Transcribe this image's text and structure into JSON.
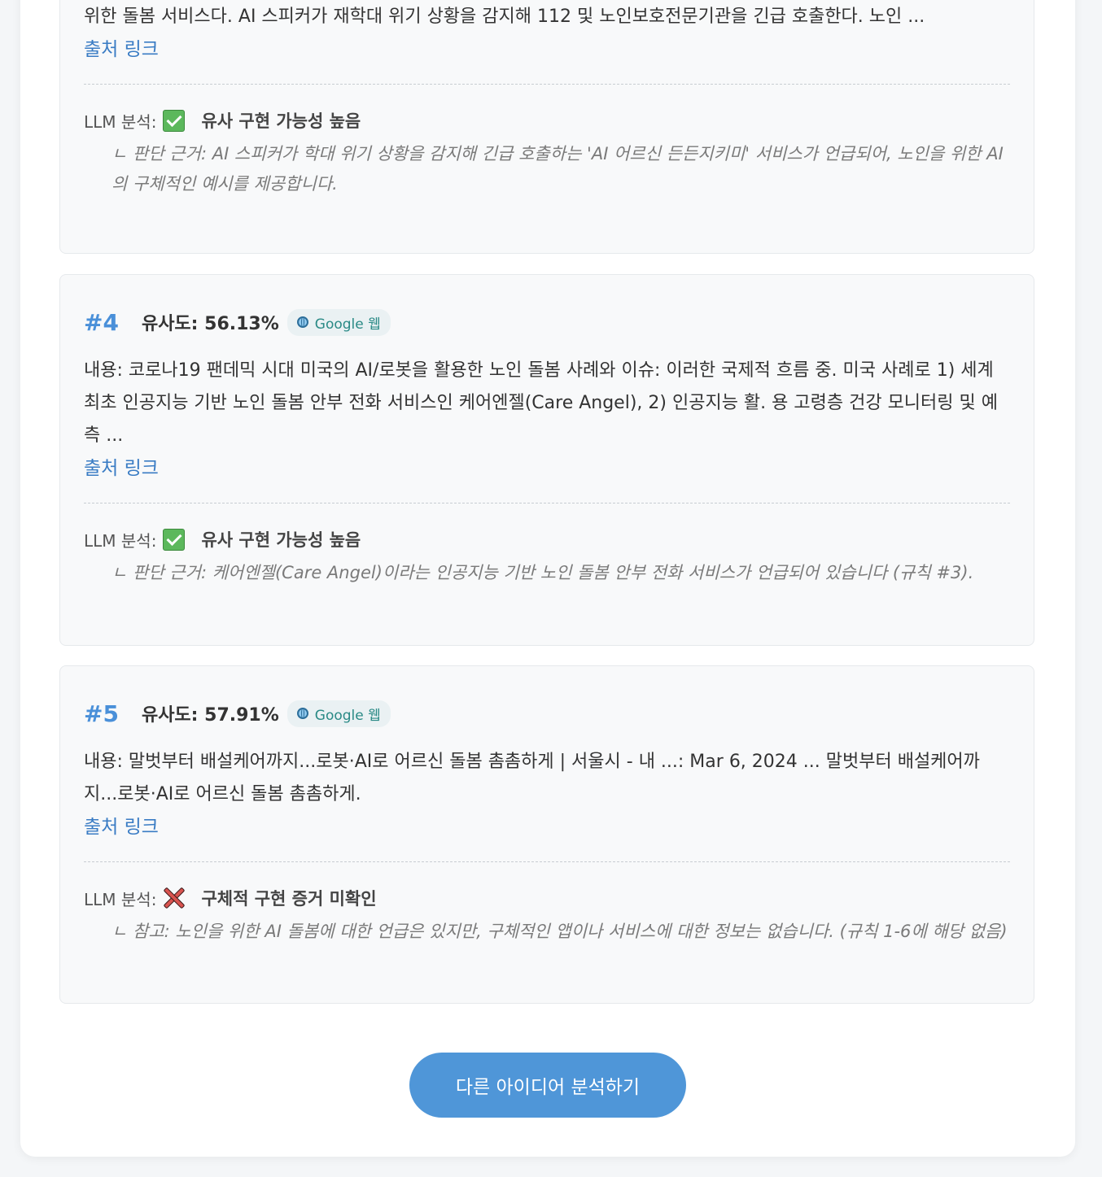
{
  "results": [
    {
      "content": "위한 돌봄 서비스다. AI 스피커가 재학대 위기 상황을 감지해 112 및 노인보호전문기관을 긴급 호출한다. 노인 ...",
      "link_label": "출처 링크",
      "llm_label": "LLM 분석:",
      "verdict": "유사 구현 가능성 높음",
      "verdict_icon": "check-icon",
      "reason": "ㄴ 판단 근거: AI 스피커가 학대 위기 상황을 감지해 긴급 호출하는 'AI 어르신 든든지키미' 서비스가 언급되어, 노인을 위한 AI의 구체적인 예시를 제공합니다."
    },
    {
      "rank": "#4",
      "similarity": "유사도: 56.13%",
      "source": "Google 웹",
      "content": "내용: 코로나19 팬데믹 시대 미국의 AI/로봇을 활용한 노인 돌봄 사례와 이슈: 이러한 국제적 흐름 중. 미국 사례로 1) 세계 최초 인공지능 기반 노인 돌봄 안부 전화 서비스인 케어엔젤(Care Angel), 2) 인공지능 활. 용 고령층 건강 모니터링 및 예측 ...",
      "link_label": "출처 링크",
      "llm_label": "LLM 분석:",
      "verdict": "유사 구현 가능성 높음",
      "verdict_icon": "check-icon",
      "reason": "ㄴ 판단 근거: 케어엔젤(Care Angel)이라는 인공지능 기반 노인 돌봄 안부 전화 서비스가 언급되어 있습니다 (규칙 #3)."
    },
    {
      "rank": "#5",
      "similarity": "유사도: 57.91%",
      "source": "Google 웹",
      "content": "내용: 말벗부터 배설케어까지...로봇·AI로 어르신 돌봄 촘촘하게 | 서울시 - 내 ...: Mar 6, 2024 ... 말벗부터 배설케어까지...로봇·AI로 어르신 돌봄 촘촘하게.",
      "link_label": "출처 링크",
      "llm_label": "LLM 분석:",
      "verdict": "구체적 구현 증거 미확인",
      "verdict_icon": "cross-icon",
      "reason": "ㄴ 참고: 노인을 위한 AI 돌봄에 대한 언급은 있지만, 구체적인 앱이나 서비스에 대한 정보는 없습니다. (규칙 1-6에 해당 없음)"
    }
  ],
  "footer": {
    "button_label": "다른 아이디어 분석하기"
  },
  "colors": {
    "accent": "#4a90d9",
    "button": "#4f96d8",
    "link": "#3a7cc4",
    "check": "#5cb85c",
    "cross": "#d9534f"
  }
}
